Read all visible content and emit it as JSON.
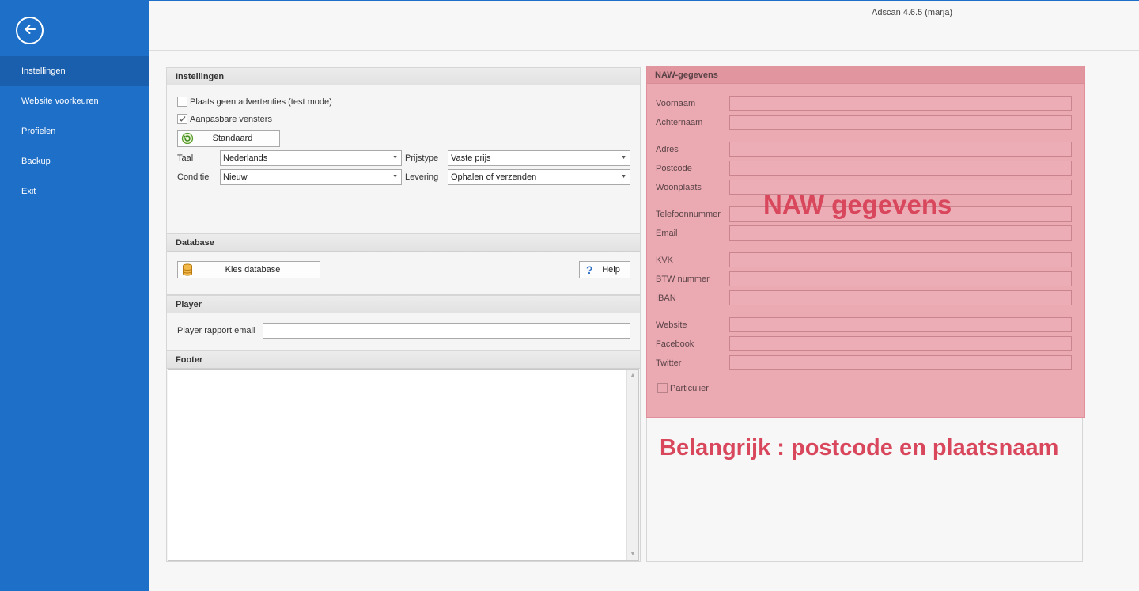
{
  "window": {
    "title": "Adscan 4.6.5 (marja)"
  },
  "sidebar": {
    "items": [
      {
        "label": "Instellingen"
      },
      {
        "label": "Website voorkeuren"
      },
      {
        "label": "Profielen"
      },
      {
        "label": "Backup"
      },
      {
        "label": "Exit"
      }
    ]
  },
  "instellingen": {
    "header": "Instellingen",
    "test_mode_label": "Plaats geen advertenties (test mode)",
    "test_mode_checked": false,
    "aanpasbare_label": "Aanpasbare vensters",
    "aanpasbare_checked": true,
    "standaard_label": "Standaard",
    "taal_label": "Taal",
    "taal_value": "Nederlands",
    "prijstype_label": "Prijstype",
    "prijstype_value": "Vaste prijs",
    "conditie_label": "Conditie",
    "conditie_value": "Nieuw",
    "levering_label": "Levering",
    "levering_value": "Ophalen of verzenden"
  },
  "database": {
    "header": "Database",
    "kies_label": "Kies database",
    "help_label": "Help"
  },
  "player": {
    "header": "Player",
    "email_label": "Player rapport email",
    "email_value": ""
  },
  "footer": {
    "header": "Footer",
    "text": ""
  },
  "naw": {
    "header": "NAW-gegevens",
    "fields": {
      "voornaam": "Voornaam",
      "achternaam": "Achternaam",
      "adres": "Adres",
      "postcode": "Postcode",
      "woonplaats": "Woonplaats",
      "telefoon": "Telefoonnummer",
      "email": "Email",
      "kvk": "KVK",
      "btw": "BTW nummer",
      "iban": "IBAN",
      "website": "Website",
      "facebook": "Facebook",
      "twitter": "Twitter"
    },
    "particulier_label": "Particulier",
    "particulier_checked": false,
    "overlay_title": "NAW gegevens"
  },
  "annotation": "Belangrijk : postcode en plaatsnaam",
  "colors": {
    "sidebar": "#1e6fc8",
    "sidebar_active": "#1a5fae",
    "highlight": "#eba9b2",
    "annotation": "#d9475d"
  }
}
